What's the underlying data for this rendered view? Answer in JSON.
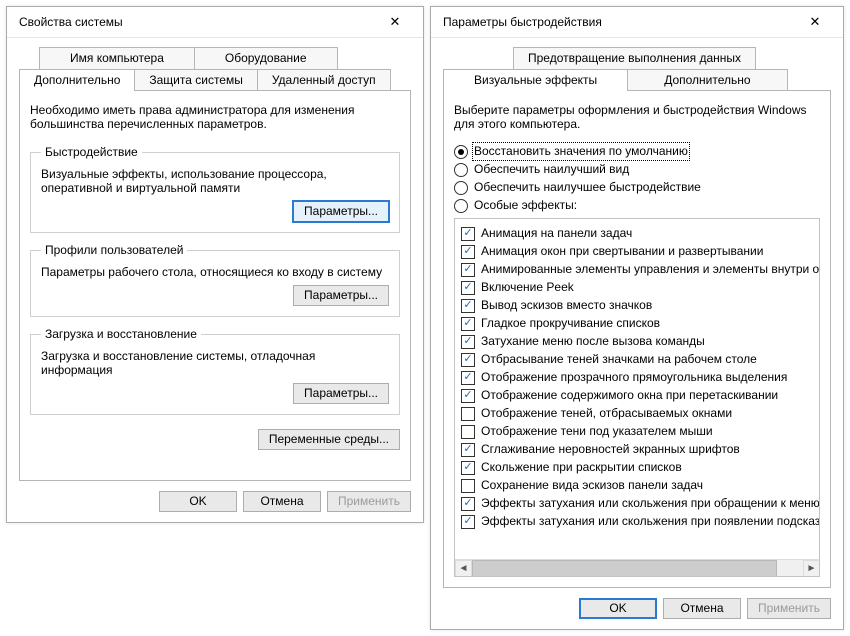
{
  "left": {
    "title": "Свойства системы",
    "tabs_row1": [
      "Имя компьютера",
      "Оборудование"
    ],
    "tabs_row2": [
      "Дополнительно",
      "Защита системы",
      "Удаленный доступ"
    ],
    "active_tab": "Дополнительно",
    "intro": "Необходимо иметь права администратора для изменения большинства перечисленных параметров.",
    "groups": {
      "perf": {
        "legend": "Быстродействие",
        "text": "Визуальные эффекты, использование процессора, оперативной и виртуальной памяти",
        "button": "Параметры..."
      },
      "profiles": {
        "legend": "Профили пользователей",
        "text": "Параметры рабочего стола, относящиеся ко входу в систему",
        "button": "Параметры..."
      },
      "startup": {
        "legend": "Загрузка и восстановление",
        "text": "Загрузка и восстановление системы, отладочная информация",
        "button": "Параметры..."
      }
    },
    "env_button": "Переменные среды...",
    "buttons": {
      "ok": "OK",
      "cancel": "Отмена",
      "apply": "Применить"
    }
  },
  "right": {
    "title": "Параметры быстродействия",
    "tabs_row1": [
      "Предотвращение выполнения данных"
    ],
    "tabs_row2": [
      "Визуальные эффекты",
      "Дополнительно"
    ],
    "active_tab": "Визуальные эффекты",
    "intro": "Выберите параметры оформления и быстродействия Windows для этого компьютера.",
    "radios": [
      {
        "label": "Восстановить значения по умолчанию",
        "selected": true
      },
      {
        "label": "Обеспечить наилучший вид",
        "selected": false
      },
      {
        "label": "Обеспечить наилучшее быстродействие",
        "selected": false
      },
      {
        "label": "Особые эффекты:",
        "selected": false
      }
    ],
    "effects": [
      {
        "label": "Анимация на панели задач",
        "checked": true
      },
      {
        "label": "Анимация окон при свертывании и развертывании",
        "checked": true
      },
      {
        "label": "Анимированные элементы управления и элементы внутри окн",
        "checked": true
      },
      {
        "label": "Включение Peek",
        "checked": true
      },
      {
        "label": "Вывод эскизов вместо значков",
        "checked": true
      },
      {
        "label": "Гладкое прокручивание списков",
        "checked": true
      },
      {
        "label": "Затухание меню после вызова команды",
        "checked": true
      },
      {
        "label": "Отбрасывание теней значками на рабочем столе",
        "checked": true
      },
      {
        "label": "Отображение прозрачного прямоугольника выделения",
        "checked": true
      },
      {
        "label": "Отображение содержимого окна при перетаскивании",
        "checked": true
      },
      {
        "label": "Отображение теней, отбрасываемых окнами",
        "checked": false
      },
      {
        "label": "Отображение тени под указателем мыши",
        "checked": false
      },
      {
        "label": "Сглаживание неровностей экранных шрифтов",
        "checked": true
      },
      {
        "label": "Скольжение при раскрытии списков",
        "checked": true
      },
      {
        "label": "Сохранение вида эскизов панели задач",
        "checked": false
      },
      {
        "label": "Эффекты затухания или скольжения при обращении к меню",
        "checked": true
      },
      {
        "label": "Эффекты затухания или скольжения при появлении подсказок",
        "checked": true
      }
    ],
    "buttons": {
      "ok": "OK",
      "cancel": "Отмена",
      "apply": "Применить"
    }
  }
}
